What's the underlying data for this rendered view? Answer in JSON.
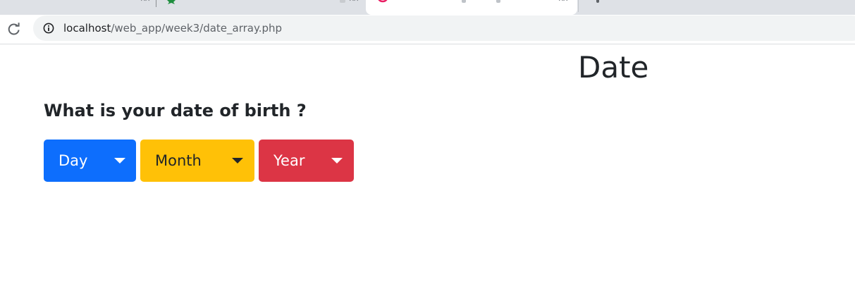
{
  "browser": {
    "address_bar": {
      "host": "localhost",
      "path": "/web_app/week3/date_array.php"
    }
  },
  "page": {
    "title": "Date",
    "question": "What is your date of birth ?",
    "dropdowns": [
      {
        "label": "Day",
        "color": "#0d6efd"
      },
      {
        "label": "Month",
        "color": "#ffc107"
      },
      {
        "label": "Year",
        "color": "#dc3545"
      }
    ]
  },
  "icons": {
    "reload": "reload-icon",
    "site_info": "info-icon",
    "caret": "caret-down-icon"
  }
}
